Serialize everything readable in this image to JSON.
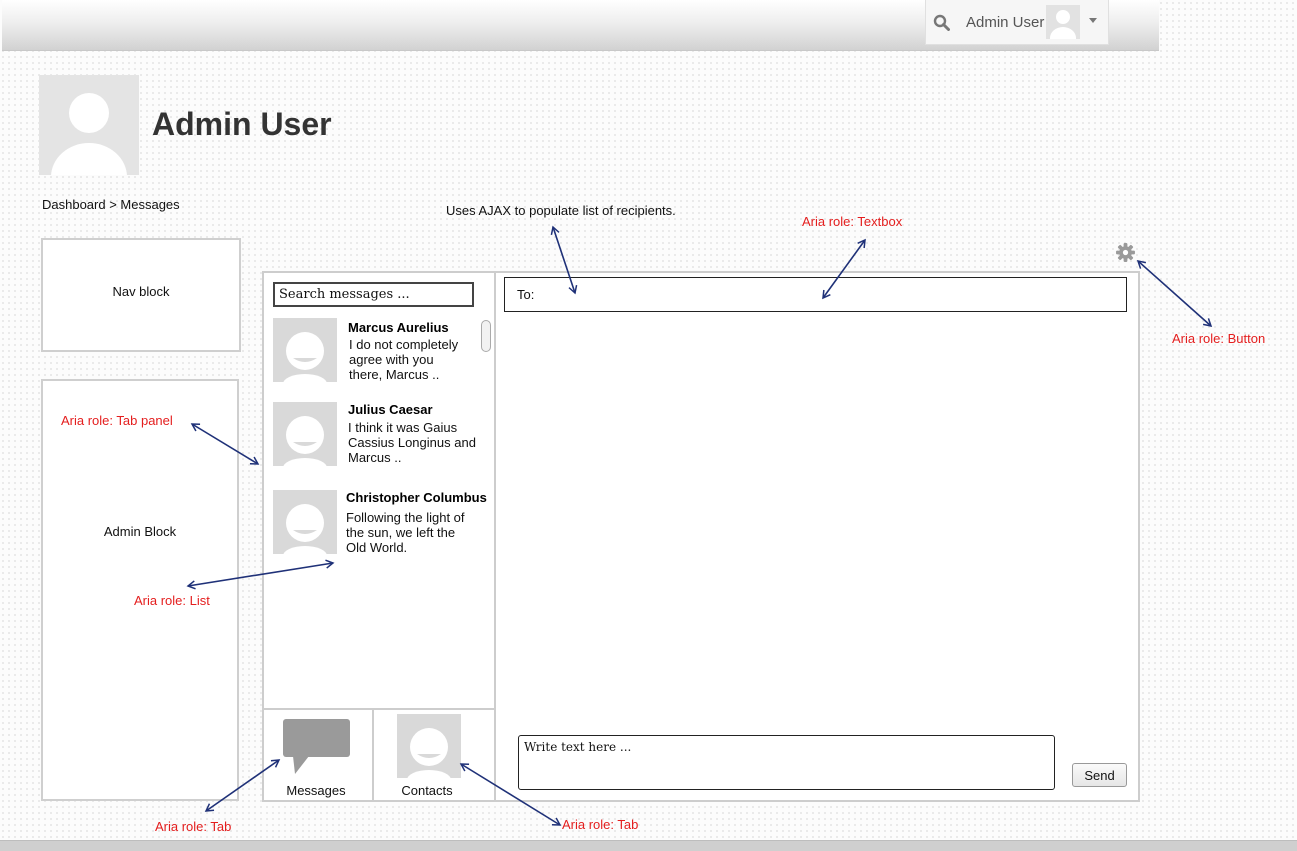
{
  "header": {
    "user_name": "Admin User",
    "icons": {
      "search": "search-icon",
      "avatar": "avatar",
      "menu": "chevron-down-icon"
    }
  },
  "profile": {
    "title": "Admin User"
  },
  "breadcrumb": "Dashboard > Messages",
  "blocks": {
    "nav": "Nav block",
    "admin": "Admin Block"
  },
  "messages": {
    "search_placeholder": "Search messages ...",
    "items": [
      {
        "name": "Marcus Aurelius",
        "lines": [
          "I do not completely",
          "agree with you",
          "there, Marcus .."
        ]
      },
      {
        "name": "Julius Caesar",
        "lines": [
          "I think it was Gaius",
          "Cassius Longinus and",
          "Marcus .."
        ]
      },
      {
        "name": "Christopher Columbus",
        "lines": [
          "Following the light of",
          "the sun, we left the",
          "Old World."
        ]
      }
    ],
    "tabs": [
      {
        "label": "Messages"
      },
      {
        "label": "Contacts"
      }
    ]
  },
  "compose": {
    "to_label": "To:",
    "placeholder": "Write text here ...",
    "send_label": "Send"
  },
  "annotations": {
    "ajax_note": "Uses AJAX to populate list of recipients.",
    "textbox": "Aria role: Textbox",
    "button": "Aria role: Button",
    "tab_panel": "Aria role: Tab panel",
    "list": "Aria role: List",
    "tab_messages": "Aria role: Tab",
    "tab_contacts": "Aria role: Tab"
  },
  "colors": {
    "annotation_red": "#e41e1e",
    "arrow_blue": "#1f3178"
  }
}
